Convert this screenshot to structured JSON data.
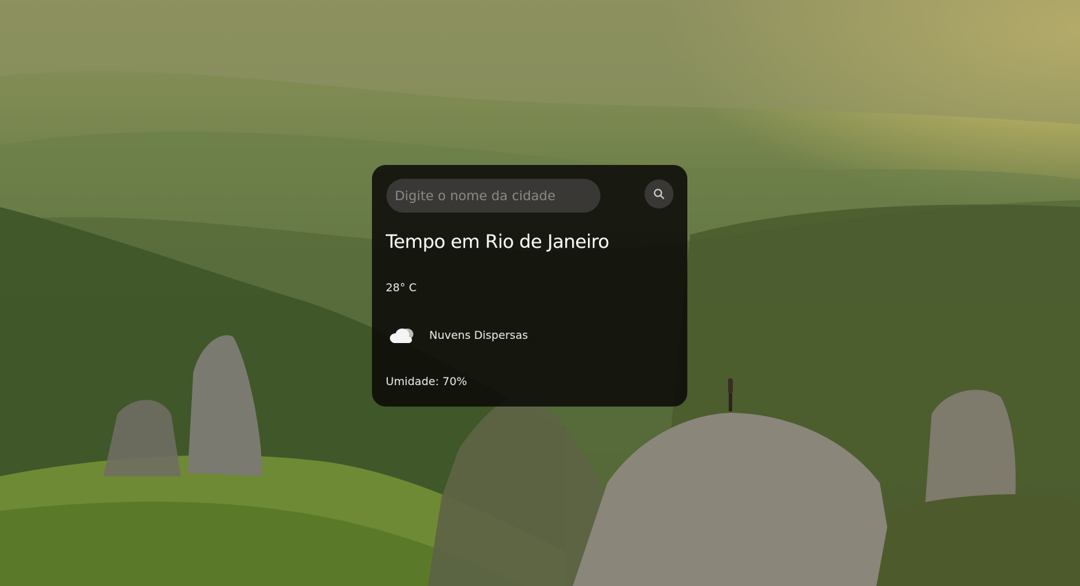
{
  "search": {
    "placeholder": "Digite o nome da cidade",
    "value": "",
    "button_icon": "search-icon"
  },
  "weather": {
    "title": "Tempo em Rio de Janeiro",
    "temperature": "28° C",
    "condition_icon": "cloud-icon",
    "condition": "Nuvens Dispersas",
    "humidity": "Umidade: 70%"
  },
  "colors": {
    "card_background": "#0a0908",
    "input_background": "#3a3835",
    "text": "#ffffff"
  }
}
